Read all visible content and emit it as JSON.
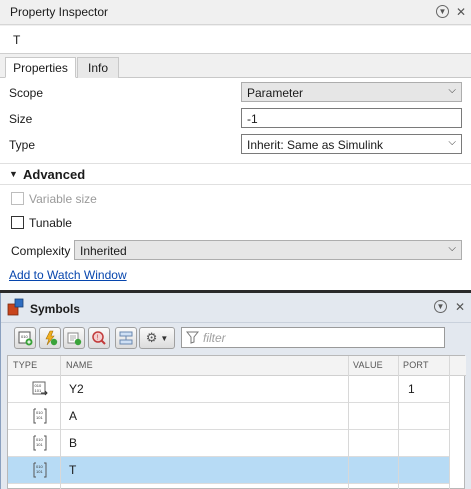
{
  "property_inspector": {
    "title": "Property Inspector",
    "name_value": "T",
    "tabs": [
      {
        "label": "Properties",
        "active": true
      },
      {
        "label": "Info",
        "active": false
      }
    ],
    "fields": {
      "scope": {
        "label": "Scope",
        "value": "Parameter"
      },
      "size": {
        "label": "Size",
        "value": "-1"
      },
      "type": {
        "label": "Type",
        "value": "Inherit: Same as Simulink"
      }
    },
    "advanced": {
      "label": "Advanced",
      "variable_size": {
        "label": "Variable size",
        "checked": false,
        "disabled": true
      },
      "tunable": {
        "label": "Tunable",
        "checked": false
      },
      "complexity": {
        "label": "Complexity",
        "value": "Inherited"
      }
    },
    "watch_link": "Add to Watch Window"
  },
  "symbols": {
    "title": "Symbols",
    "filter_placeholder": "filter",
    "columns": [
      "TYPE",
      "NAME",
      "VALUE",
      "PORT"
    ],
    "rows": [
      {
        "type_icon": "output-data-icon",
        "name": "Y2",
        "value": "",
        "port": "1",
        "selected": false
      },
      {
        "type_icon": "parameter-icon",
        "name": "A",
        "value": "",
        "port": "",
        "selected": false
      },
      {
        "type_icon": "parameter-icon",
        "name": "B",
        "value": "",
        "port": "",
        "selected": false
      },
      {
        "type_icon": "parameter-icon",
        "name": "T",
        "value": "",
        "port": "",
        "selected": true
      }
    ]
  },
  "colors": {
    "selection": "#b7dbf5",
    "link": "#0645ad",
    "panel_bg": "#e3e8ef"
  }
}
